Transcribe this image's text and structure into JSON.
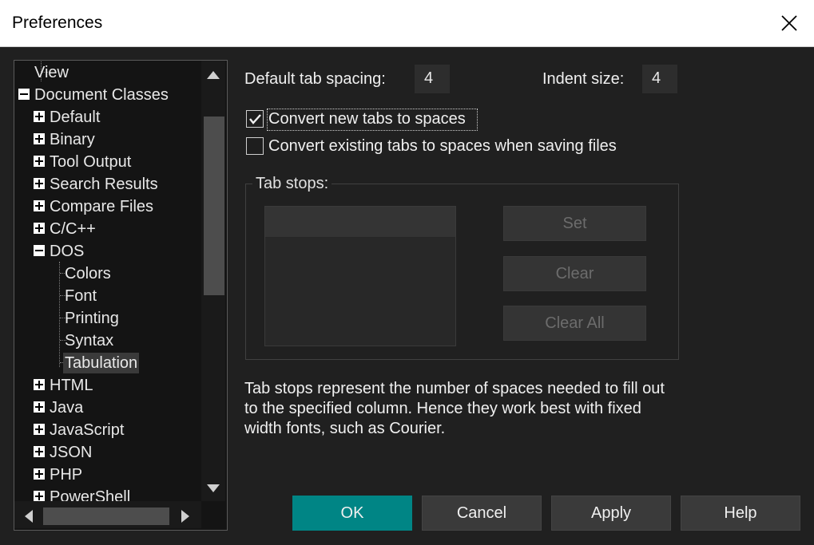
{
  "window": {
    "title": "Preferences",
    "close_icon": "close-icon"
  },
  "tree": {
    "nodes": [
      {
        "label": "View",
        "state": "leaf"
      },
      {
        "label": "Document Classes",
        "state": "expanded"
      },
      {
        "label": "Default",
        "state": "collapsed"
      },
      {
        "label": "Binary",
        "state": "collapsed"
      },
      {
        "label": "Tool Output",
        "state": "collapsed"
      },
      {
        "label": "Search Results",
        "state": "collapsed"
      },
      {
        "label": "Compare Files",
        "state": "collapsed"
      },
      {
        "label": "C/C++",
        "state": "collapsed"
      },
      {
        "label": "DOS",
        "state": "expanded"
      },
      {
        "label": "Colors",
        "state": "leaf"
      },
      {
        "label": "Font",
        "state": "leaf"
      },
      {
        "label": "Printing",
        "state": "leaf"
      },
      {
        "label": "Syntax",
        "state": "leaf"
      },
      {
        "label": "Tabulation",
        "state": "leaf",
        "selected": true
      },
      {
        "label": "HTML",
        "state": "collapsed"
      },
      {
        "label": "Java",
        "state": "collapsed"
      },
      {
        "label": "JavaScript",
        "state": "collapsed"
      },
      {
        "label": "JSON",
        "state": "collapsed"
      },
      {
        "label": "PHP",
        "state": "collapsed"
      },
      {
        "label": "PowerShell",
        "state": "collapsed"
      }
    ]
  },
  "settings": {
    "default_tab_spacing_label": "Default tab spacing:",
    "default_tab_spacing_value": "4",
    "indent_size_label": "Indent size:",
    "indent_size_value": "4",
    "convert_new_tabs_label": "Convert new tabs to spaces",
    "convert_new_tabs_checked": true,
    "convert_existing_tabs_label": "Convert existing tabs to spaces when saving files",
    "convert_existing_tabs_checked": false
  },
  "tab_stops": {
    "group_label": "Tab stops:",
    "set_label": "Set",
    "clear_label": "Clear",
    "clear_all_label": "Clear All"
  },
  "note": {
    "line1": "Tab stops represent the number of spaces needed to fill out",
    "line2": "to the specified column.  Hence they work best with fixed",
    "line3": "width fonts, such as Courier."
  },
  "buttons": {
    "ok": "OK",
    "cancel": "Cancel",
    "apply": "Apply",
    "help": "Help"
  },
  "colors": {
    "accent": "#008585",
    "background": "#202020"
  }
}
